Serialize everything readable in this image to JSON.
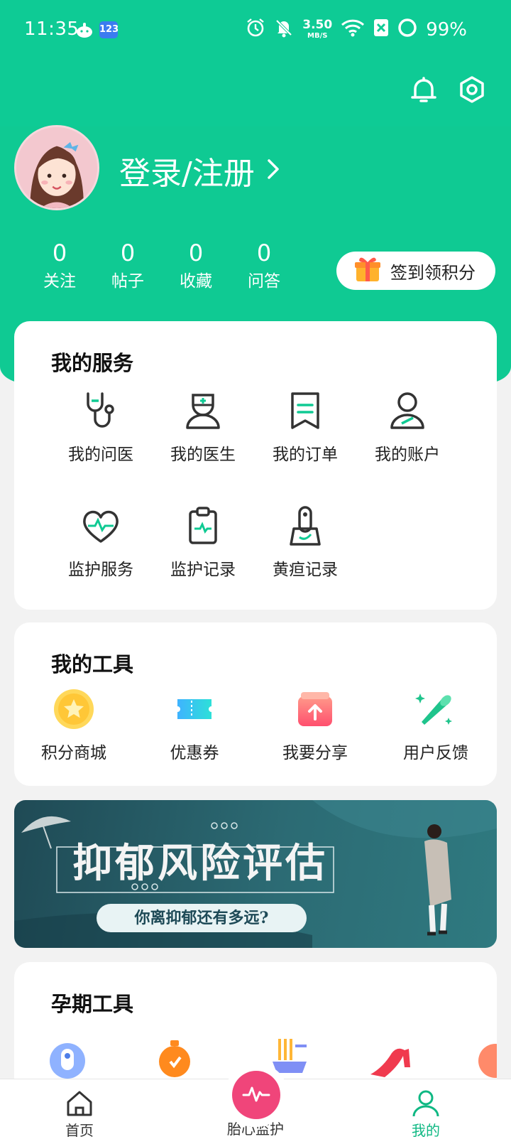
{
  "status_bar": {
    "time": "11:35",
    "app_badge": "123",
    "net_speed": "3.50",
    "net_unit": "MB/S",
    "battery": "99%"
  },
  "header": {
    "login_text": "登录/注册",
    "checkin_label": "签到领积分"
  },
  "stats": [
    {
      "value": "0",
      "label": "关注"
    },
    {
      "value": "0",
      "label": "帖子"
    },
    {
      "value": "0",
      "label": "收藏"
    },
    {
      "value": "0",
      "label": "问答"
    }
  ],
  "services": {
    "title": "我的服务",
    "items": [
      {
        "label": "我的问医",
        "icon": "stethoscope-icon"
      },
      {
        "label": "我的医生",
        "icon": "doctor-icon"
      },
      {
        "label": "我的订单",
        "icon": "order-icon"
      },
      {
        "label": "我的账户",
        "icon": "user-icon"
      },
      {
        "label": "监护服务",
        "icon": "heart-monitor-icon"
      },
      {
        "label": "监护记录",
        "icon": "clipboard-icon"
      },
      {
        "label": "黄疸记录",
        "icon": "jaundice-device-icon"
      }
    ]
  },
  "tools": {
    "title": "我的工具",
    "items": [
      {
        "label": "积分商城",
        "icon": "star-coin-icon"
      },
      {
        "label": "优惠券",
        "icon": "coupon-icon"
      },
      {
        "label": "我要分享",
        "icon": "share-icon"
      },
      {
        "label": "用户反馈",
        "icon": "megaphone-icon"
      }
    ]
  },
  "banner": {
    "title": "抑郁风险评估",
    "subtitle": "你离抑郁还有多远?"
  },
  "pregnancy_tools": {
    "title": "孕期工具"
  },
  "bottom_nav": [
    {
      "label": "首页"
    },
    {
      "label": "胎心监护"
    },
    {
      "label": "我的"
    }
  ],
  "colors": {
    "brand": "#0fca93",
    "active": "#0fb883",
    "accent_pink": "#f0457a"
  }
}
